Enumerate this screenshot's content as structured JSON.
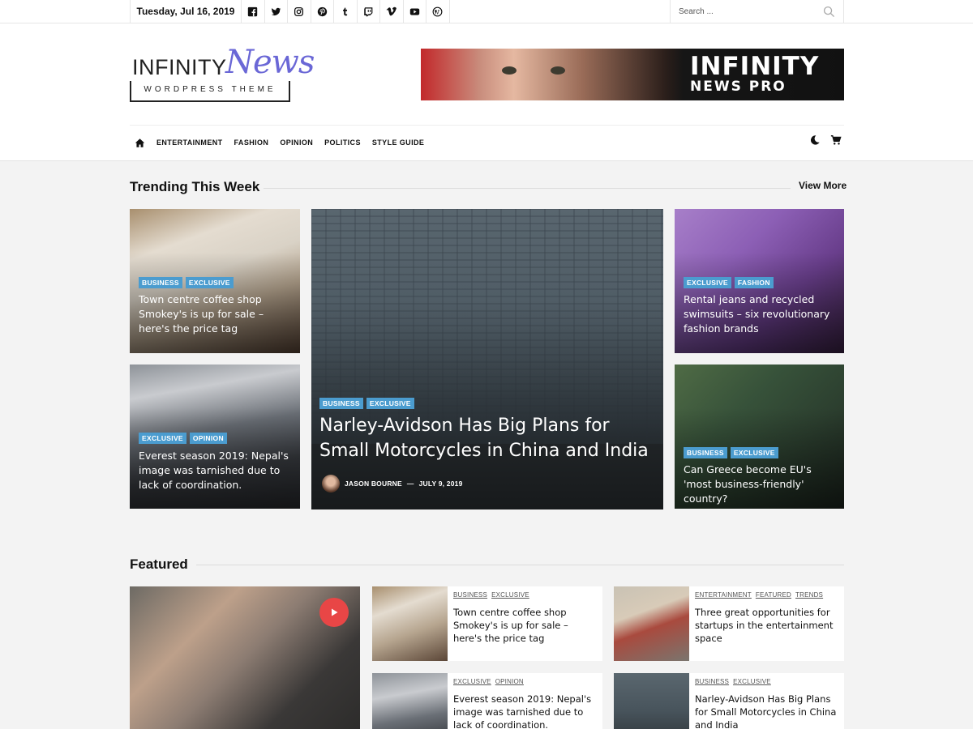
{
  "topbar": {
    "date": "Tuesday, Jul 16, 2019",
    "socials": [
      "facebook-icon",
      "twitter-icon",
      "instagram-icon",
      "pinterest-icon",
      "tumblr-icon",
      "twitch-icon",
      "vimeo-icon",
      "youtube-icon",
      "wordpress-icon"
    ],
    "search_placeholder": "Search ..."
  },
  "header": {
    "logo_main": "INFINITY",
    "logo_script": "News",
    "logo_sub": "WORDPRESS THEME",
    "banner_line1": "INFINITY",
    "banner_line2": "NEWS PRO"
  },
  "nav": {
    "items": [
      "ENTERTAINMENT",
      "FASHION",
      "OPINION",
      "POLITICS",
      "STYLE GUIDE"
    ]
  },
  "trending": {
    "title": "Trending This Week",
    "view_more": "View More",
    "cards": [
      {
        "tags": [
          "BUSINESS",
          "EXCLUSIVE"
        ],
        "title": "Town centre coffee shop Smokey's is up for sale – here's the price tag"
      },
      {
        "tags": [
          "EXCLUSIVE",
          "OPINION"
        ],
        "title": "Everest season 2019: Nepal's image was tarnished due to lack of coordination."
      },
      {
        "tags": [
          "BUSINESS",
          "EXCLUSIVE"
        ],
        "title": "Narley-Avidson Has Big Plans for Small Motorcycles in China and India",
        "author": "JASON BOURNE",
        "sep": "—",
        "date": "JULY 9, 2019"
      },
      {
        "tags": [
          "EXCLUSIVE",
          "FASHION"
        ],
        "title": "Rental jeans and recycled swimsuits – six revolutionary fashion brands"
      },
      {
        "tags": [
          "BUSINESS",
          "EXCLUSIVE"
        ],
        "title": "Can Greece become EU's 'most business-friendly' country?"
      }
    ]
  },
  "featured": {
    "title": "Featured",
    "cards": [
      {
        "tags": [
          "BUSINESS",
          "EXCLUSIVE"
        ],
        "title": "Town centre coffee shop Smokey's is up for sale – here's the price tag"
      },
      {
        "tags": [
          "ENTERTAINMENT",
          "FEATURED",
          "TRENDS"
        ],
        "title": "Three great opportunities for startups in the entertainment space"
      },
      {
        "tags": [
          "EXCLUSIVE",
          "OPINION"
        ],
        "title": "Everest season 2019: Nepal's image was tarnished due to lack of coordination."
      },
      {
        "tags": [
          "BUSINESS",
          "EXCLUSIVE"
        ],
        "title": "Narley-Avidson Has Big Plans for Small Motorcycles in China and India"
      }
    ]
  },
  "colors": {
    "tag_bg": "#4b9ccf",
    "logo_accent": "#6a67d6",
    "play_button": "#e84646"
  }
}
